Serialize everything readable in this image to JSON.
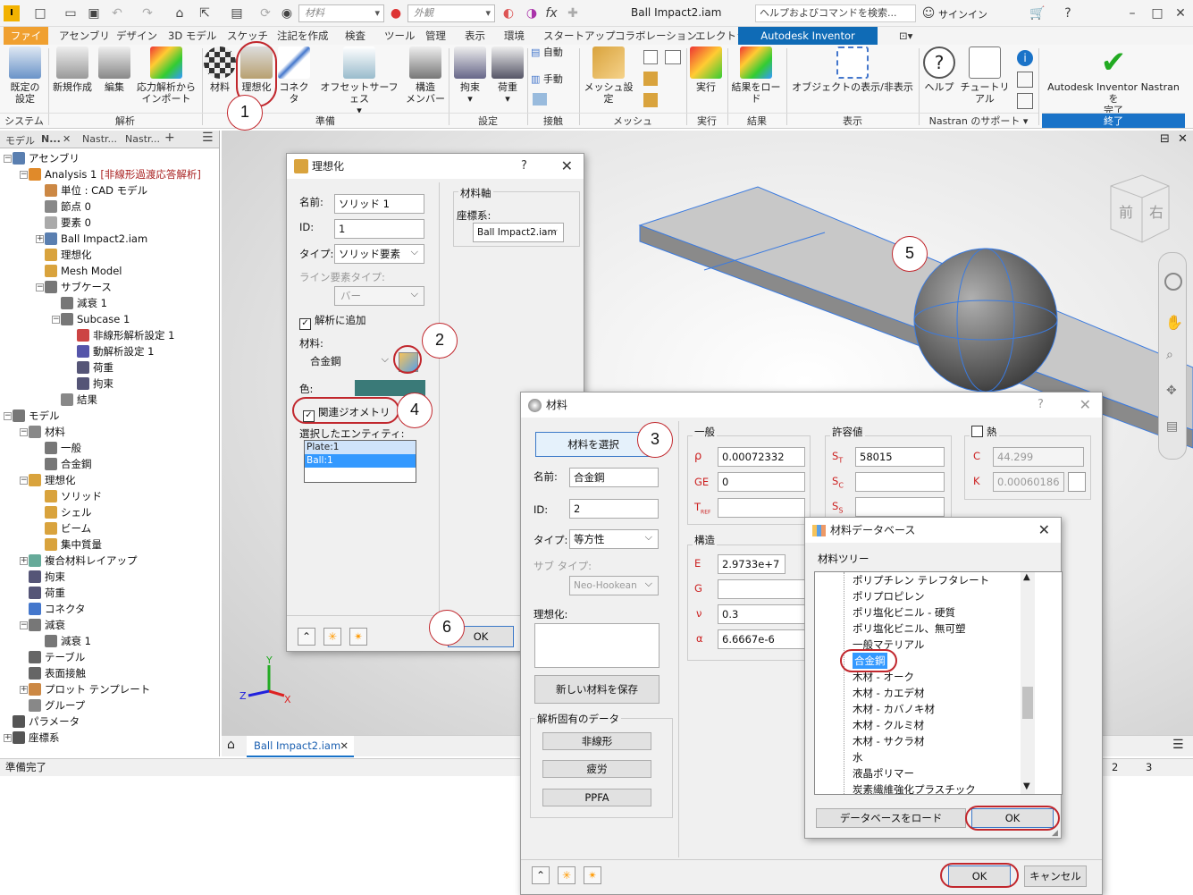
{
  "app_title": "Ball Impact2.iam",
  "qat": {
    "material_combo": "材料",
    "appearance_combo": "外観",
    "search_placeholder": "ヘルプおよびコマンドを検索...",
    "signin": "サインイン"
  },
  "menu_tabs": [
    "ファイル",
    "アセンブリ",
    "デザイン",
    "3D モデル",
    "スケッチ",
    "注記を作成",
    "検査",
    "ツール",
    "管理",
    "表示",
    "環境",
    "スタートアップ",
    "コラボレーション",
    "エレクトラ",
    "Autodesk Inventor Nastran"
  ],
  "ribbon": {
    "buttons": [
      {
        "label": "既定の\n設定"
      },
      {
        "label": "新規作成"
      },
      {
        "label": "編集"
      },
      {
        "label": "応力解析から\nインポート"
      },
      {
        "label": "材料"
      },
      {
        "label": "理想化"
      },
      {
        "label": "コネクタ"
      },
      {
        "label": "オフセットサーフェス"
      },
      {
        "label": "構造\nメンバー"
      },
      {
        "label": "拘束"
      },
      {
        "label": "荷重"
      },
      {
        "label": "自動"
      },
      {
        "label": "手動"
      },
      {
        "label": "メッシュ設定"
      },
      {
        "label": "実行"
      },
      {
        "label": "結果をロード"
      },
      {
        "label": "オブジェクトの表示/非表示"
      },
      {
        "label": "ヘルプ"
      },
      {
        "label": "チュートリアル"
      },
      {
        "label": "Autodesk Inventor Nastran を\n完了"
      }
    ],
    "groups": [
      "システム",
      "解析",
      "準備",
      "設定",
      "接触",
      "メッシュ",
      "実行",
      "結果",
      "表示",
      "Nastran のサポート",
      "終了"
    ]
  },
  "browser": {
    "tabs": [
      "モデル",
      "N...",
      "Nastr...",
      "Nastr..."
    ],
    "tree": [
      {
        "label": "アセンブリ",
        "lv": 0
      },
      {
        "label": "Analysis 1",
        "extra": "[非線形過渡応答解析]",
        "lv": 1
      },
      {
        "label": "単位 : CAD モデル",
        "lv": 2
      },
      {
        "label": "節点 0",
        "lv": 2
      },
      {
        "label": "要素 0",
        "lv": 2
      },
      {
        "label": "Ball Impact2.iam",
        "lv": 2
      },
      {
        "label": "理想化",
        "lv": 2
      },
      {
        "label": "Mesh Model",
        "lv": 2
      },
      {
        "label": "サブケース",
        "lv": 2
      },
      {
        "label": "減衰 1",
        "lv": 3
      },
      {
        "label": "Subcase 1",
        "lv": 3
      },
      {
        "label": "非線形解析設定 1",
        "lv": 4
      },
      {
        "label": "動解析設定 1",
        "lv": 4
      },
      {
        "label": "荷重",
        "lv": 4
      },
      {
        "label": "拘束",
        "lv": 4
      },
      {
        "label": "結果",
        "lv": 3
      },
      {
        "label": "モデル",
        "lv": 0
      },
      {
        "label": "材料",
        "lv": 1
      },
      {
        "label": "一般",
        "lv": 2
      },
      {
        "label": "合金鋼",
        "lv": 2
      },
      {
        "label": "理想化",
        "lv": 1
      },
      {
        "label": "ソリッド",
        "lv": 2
      },
      {
        "label": "シェル",
        "lv": 2
      },
      {
        "label": "ビーム",
        "lv": 2
      },
      {
        "label": "集中質量",
        "lv": 2
      },
      {
        "label": "複合材料レイアップ",
        "lv": 1
      },
      {
        "label": "拘束",
        "lv": 1
      },
      {
        "label": "荷重",
        "lv": 1
      },
      {
        "label": "コネクタ",
        "lv": 1
      },
      {
        "label": "減衰",
        "lv": 1
      },
      {
        "label": "減衰 1",
        "lv": 2
      },
      {
        "label": "テーブル",
        "lv": 1
      },
      {
        "label": "表面接触",
        "lv": 1
      },
      {
        "label": "プロット テンプレート",
        "lv": 1
      },
      {
        "label": "グループ",
        "lv": 1
      },
      {
        "label": "パラメータ",
        "lv": 0
      },
      {
        "label": "座標系",
        "lv": 0
      }
    ]
  },
  "viewport": {
    "doc_tab": "Ball Impact2.iam",
    "viewcube_front": "前",
    "viewcube_right": "右",
    "page_nums": [
      "2",
      "3"
    ],
    "axes": {
      "x": "X",
      "y": "Y",
      "z": "Z"
    }
  },
  "status": "準備完了",
  "idealize_dialog": {
    "title": "理想化",
    "help": "?",
    "name_label": "名前:",
    "name": "ソリッド 1",
    "id_label": "ID:",
    "id": "1",
    "type_label": "タイプ:",
    "type": "ソリッド要素",
    "line_type_label": "ライン要素タイプ:",
    "line_type": "バー",
    "add_to_analysis": "解析に追加",
    "material_label": "材料:",
    "material": "合金鋼",
    "color_label": "色:",
    "color": "#3a7a78",
    "assoc_geometry": "関連ジオメトリ",
    "selected_label": "選択したエンティティ:",
    "entities": [
      "Plate:1",
      "Ball:1"
    ],
    "material_axis": "材料軸",
    "coord_label": "座標系:",
    "coord": "Ball Impact2.iam",
    "ok": "OK"
  },
  "material_dialog": {
    "title": "材料",
    "help": "?",
    "select_button": "材料を選択",
    "name_label": "名前:",
    "name": "合金鋼",
    "id_label": "ID:",
    "id": "2",
    "type_label": "タイプ:",
    "type": "等方性",
    "subtype_label": "サブ タイプ:",
    "subtype": "Neo-Hookean",
    "idealize_label": "理想化:",
    "save_button": "新しい材料を保存",
    "analysis_data": "解析固有のデータ",
    "nonlinear": "非線形",
    "fatigue": "疲労",
    "ppfa": "PPFA",
    "general": "一般",
    "rho_label": "ρ",
    "rho": "0.00072332",
    "ge_label": "GE",
    "ge": "0",
    "tref_label": "T",
    "tref_sub": "REF",
    "tref": "",
    "allow": "許容値",
    "st_label": "S",
    "st_sub": "T",
    "st": "58015",
    "sc_label": "S",
    "sc_sub": "C",
    "sc": "",
    "ss_label": "S",
    "ss_sub": "S",
    "ss": "",
    "heat": "熱",
    "c_label": "C",
    "c": "44.299",
    "k_label": "K",
    "k": "0.00060186",
    "structure": "構造",
    "e_label": "E",
    "e": "2.9733e+7",
    "g_label": "G",
    "g": "",
    "nu_label": "ν",
    "nu": "0.3",
    "alpha_label": "α",
    "alpha": "6.6667e-6",
    "ok": "OK",
    "cancel": "キャンセル"
  },
  "db_dialog": {
    "title": "材料データベース",
    "tree_label": "材料ツリー",
    "items": [
      "ポリプチレン テレフタレート",
      "ポリプロピレン",
      "ポリ塩化ビニル - 硬質",
      "ポリ塩化ビニル、無可塑",
      "一般マテリアル",
      "合金鋼",
      "木材 - オーク",
      "木材 - カエデ材",
      "木材 - カバノキ材",
      "木材 - クルミ材",
      "木材 - サクラ材",
      "水",
      "液晶ポリマー",
      "炭素繊維強化プラスチック"
    ],
    "selected_index": 5,
    "load_button": "データベースをロード",
    "ok": "OK"
  },
  "callouts": [
    "1",
    "2",
    "3",
    "4",
    "5",
    "6"
  ],
  "colors": {
    "ribbon_active_tab": "#0f6bb6",
    "selection": "#3399ff",
    "callout_red": "#c1272d"
  }
}
